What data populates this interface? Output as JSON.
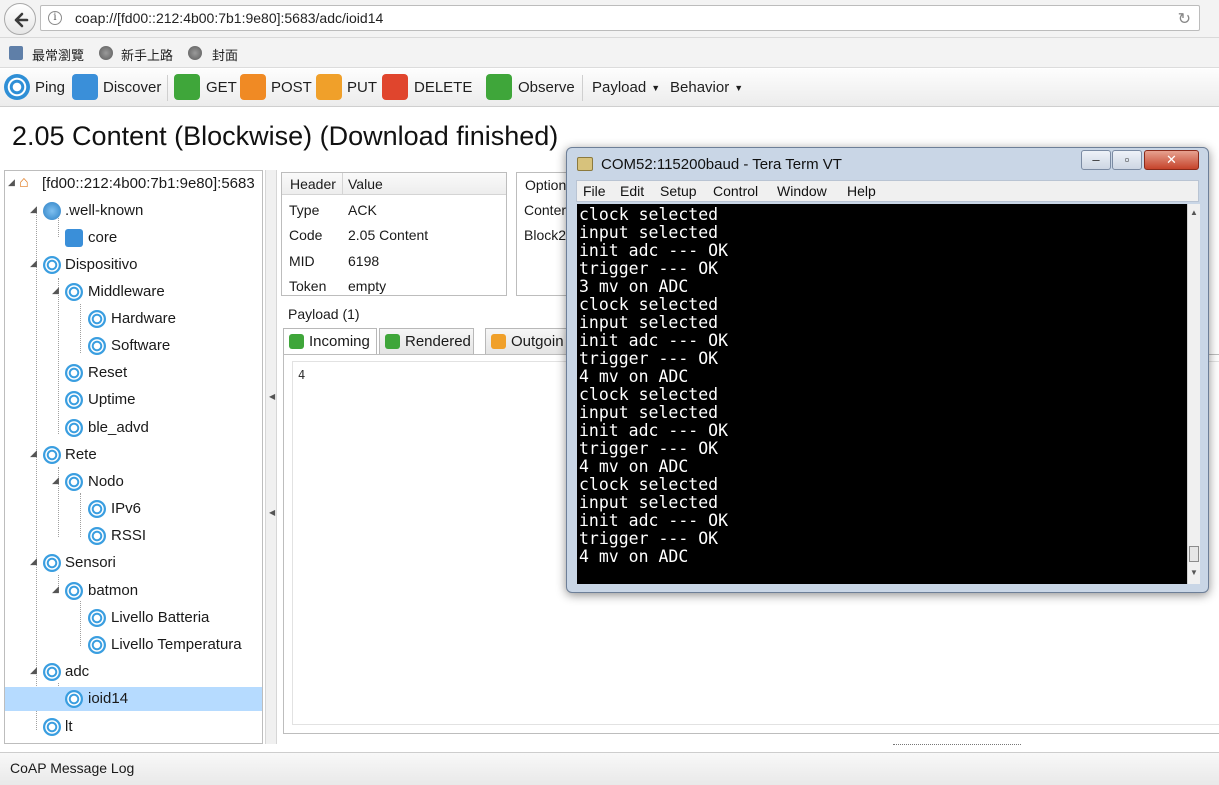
{
  "browser": {
    "url": "coap://[fd00::212:4b00:7b1:9e80]:5683/adc/ioid14",
    "bookmarks": [
      "最常瀏覽",
      "新手上路",
      "封面"
    ]
  },
  "toolbar": {
    "ping": "Ping",
    "discover": "Discover",
    "get": "GET",
    "post": "POST",
    "put": "PUT",
    "delete": "DELETE",
    "observe": "Observe",
    "payload": "Payload",
    "behavior": "Behavior"
  },
  "status": "2.05 Content (Blockwise) (Download finished)",
  "tree": {
    "root": "[fd00::212:4b00:7b1:9e80]:5683",
    "well_known": ".well-known",
    "core": "core",
    "dispositivo": "Dispositivo",
    "middleware": "Middleware",
    "hardware": "Hardware",
    "software": "Software",
    "reset": "Reset",
    "uptime": "Uptime",
    "ble_advd": "ble_advd",
    "rete": "Rete",
    "nodo": "Nodo",
    "ipv6": "IPv6",
    "rssi": "RSSI",
    "sensori": "Sensori",
    "batmon": "batmon",
    "livello_batteria": "Livello Batteria",
    "livello_temperatura": "Livello Temperatura",
    "adc": "adc",
    "ioid14": "ioid14",
    "lt": "lt"
  },
  "header_table": {
    "col_header": "Header",
    "col_value": "Value",
    "rows": [
      {
        "key": "Type",
        "value": "ACK"
      },
      {
        "key": "Code",
        "value": "2.05 Content"
      },
      {
        "key": "MID",
        "value": "6198"
      },
      {
        "key": "Token",
        "value": "empty"
      }
    ]
  },
  "options_table": {
    "col_header": "Option",
    "rows": [
      "Conter",
      "Block2"
    ]
  },
  "payload": {
    "title": "Payload (1)",
    "tabs": [
      "Incoming",
      "Rendered",
      "Outgoin"
    ],
    "content": "4"
  },
  "log": {
    "label": "CoAP Message Log"
  },
  "teraterm": {
    "title": "COM52:115200baud - Tera Term VT",
    "menu": [
      "File",
      "Edit",
      "Setup",
      "Control",
      "Window",
      "Help"
    ],
    "lines": [
      "clock selected",
      "input selected",
      "init adc --- OK",
      "trigger --- OK",
      "3 mv on ADC",
      "clock selected",
      "input selected",
      "init adc --- OK",
      "trigger --- OK",
      "4 mv on ADC",
      "clock selected",
      "input selected",
      "init adc --- OK",
      "trigger --- OK",
      "4 mv on ADC",
      "clock selected",
      "input selected",
      "init adc --- OK",
      "trigger --- OK",
      "4 mv on ADC"
    ]
  },
  "colors": {
    "tree_selection": "#b6dbff",
    "node_icon": "#3a9ee0",
    "terminal_bg": "#000000",
    "terminal_fg": "#ffffff"
  }
}
